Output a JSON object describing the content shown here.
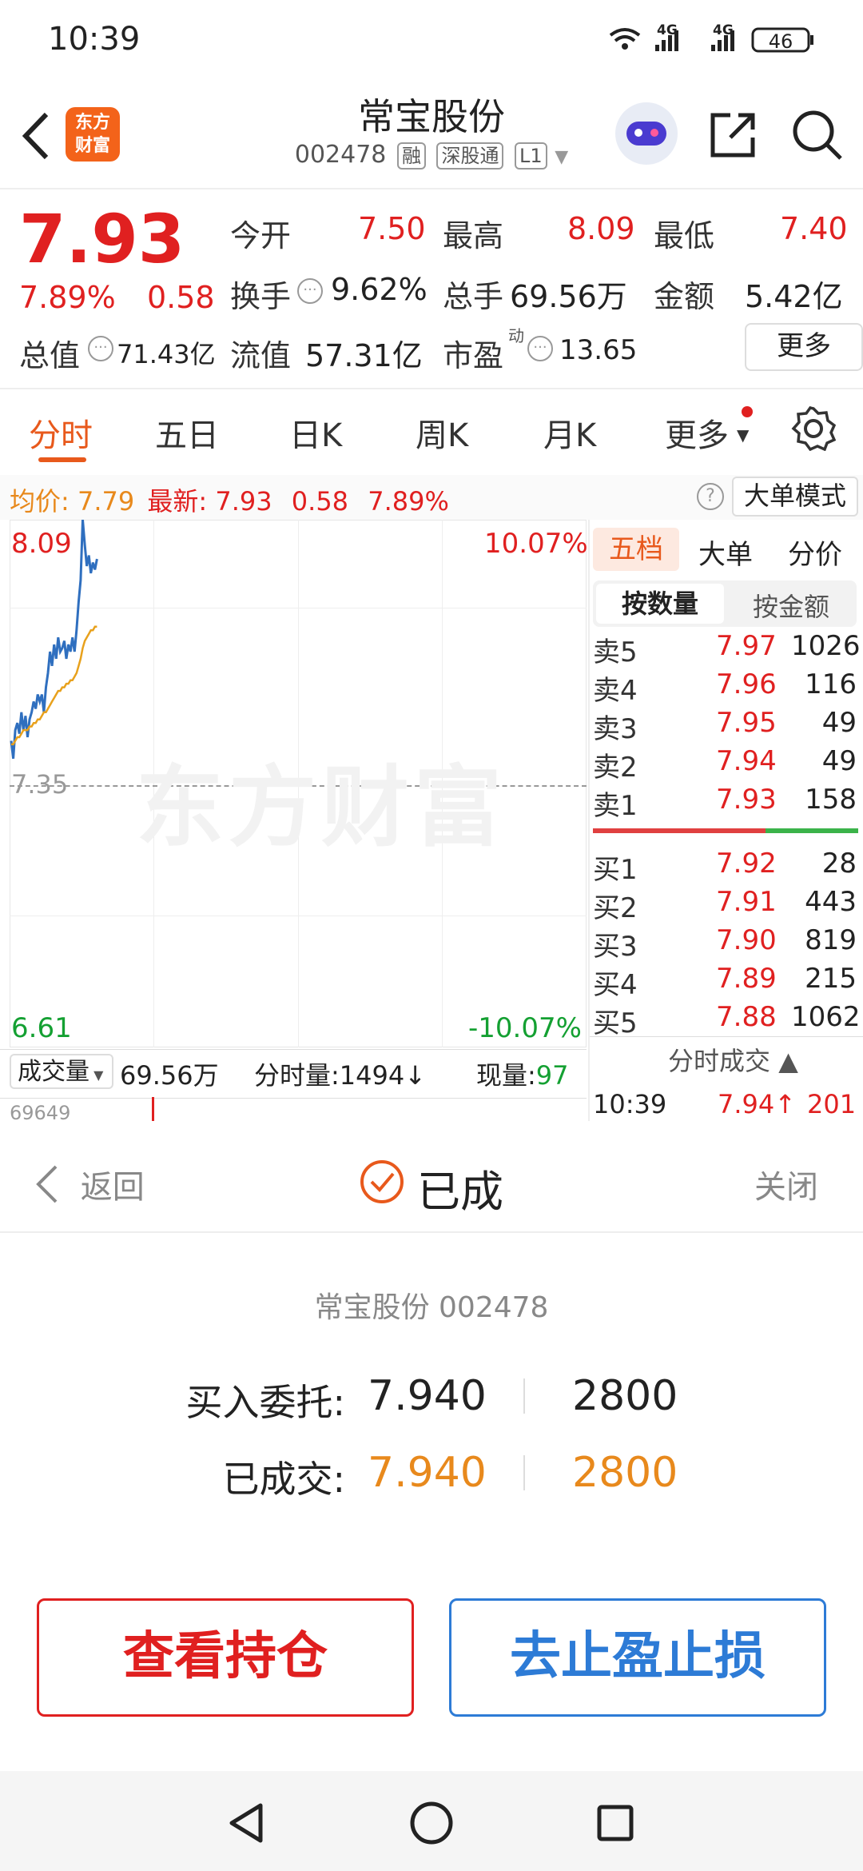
{
  "status_bar": {
    "time": "10:39",
    "network1": "4G",
    "network2": "4G",
    "battery": "46"
  },
  "header": {
    "logo_text_line1": "东方",
    "logo_text_line2": "财富",
    "stock_name": "常宝股份",
    "stock_code": "002478",
    "tags": [
      "融",
      "深股通",
      "L1"
    ]
  },
  "quote": {
    "price": "7.93",
    "change_pct": "7.89%",
    "change": "0.58",
    "open_label": "今开",
    "open": "7.50",
    "high_label": "最高",
    "high": "8.09",
    "low_label": "最低",
    "low": "7.40",
    "turnover_label": "换手",
    "turnover": "9.62%",
    "volume_label": "总手",
    "volume": "69.56万",
    "amount_label": "金额",
    "amount": "5.42亿",
    "total_value_label": "总值",
    "total_value": "71.43亿",
    "float_value_label": "流值",
    "float_value": "57.31亿",
    "pe_label": "市盈",
    "pe_superscript": "动",
    "pe": "13.65",
    "more_button": "更多"
  },
  "tabs": [
    "分时",
    "五日",
    "日K",
    "周K",
    "月K",
    "更多"
  ],
  "chart_info": {
    "avg_label": "均价:",
    "avg": "7.79",
    "latest_label": "最新:",
    "latest": "7.93",
    "change": "0.58",
    "change_pct": "7.89%",
    "mode_button": "大单模式"
  },
  "chart_data": {
    "type": "line",
    "y_top_label": "8.09",
    "y_mid_label": "7.35",
    "y_bottom_label": "6.61",
    "pct_top_label": "10.07%",
    "pct_bottom_label": "-10.07%",
    "ylim": [
      6.61,
      8.09
    ],
    "watermark": "东方财富",
    "series": [
      {
        "values": [
          7.47,
          7.42,
          7.5,
          7.52,
          7.49,
          7.55,
          7.5,
          7.54,
          7.48,
          7.53,
          7.55,
          7.58,
          7.56,
          7.6,
          7.58,
          7.6,
          7.55,
          7.62,
          7.66,
          7.72,
          7.68,
          7.74,
          7.7,
          7.76,
          7.72,
          7.73,
          7.75,
          7.7,
          7.74,
          7.72,
          7.76,
          7.72,
          7.78,
          7.86,
          7.92,
          8.09,
          8.02,
          7.96,
          7.99,
          7.94,
          7.97,
          7.95,
          7.98
        ]
      },
      {
        "values": [
          7.46,
          7.46,
          7.47,
          7.48,
          7.48,
          7.49,
          7.5,
          7.5,
          7.5,
          7.51,
          7.51,
          7.52,
          7.52,
          7.53,
          7.53,
          7.54,
          7.55,
          7.55,
          7.56,
          7.57,
          7.58,
          7.59,
          7.6,
          7.61,
          7.61,
          7.62,
          7.62,
          7.63,
          7.63,
          7.64,
          7.64,
          7.65,
          7.66,
          7.68,
          7.7,
          7.73,
          7.75,
          7.76,
          7.77,
          7.78,
          7.78,
          7.79,
          7.79
        ]
      }
    ]
  },
  "volume_bar": {
    "label": "成交量",
    "value": "69.56万",
    "minute_label": "分时量:",
    "minute_value": "1494",
    "current_label": "现量:",
    "current_value": "97",
    "axis_value": "69649"
  },
  "orderbook": {
    "tabs": [
      "五档",
      "大单",
      "分价"
    ],
    "toggle": [
      "按数量",
      "按金额"
    ],
    "asks": [
      {
        "label": "卖5",
        "price": "7.97",
        "qty": "1026"
      },
      {
        "label": "卖4",
        "price": "7.96",
        "qty": "116"
      },
      {
        "label": "卖3",
        "price": "7.95",
        "qty": "49"
      },
      {
        "label": "卖2",
        "price": "7.94",
        "qty": "49"
      },
      {
        "label": "卖1",
        "price": "7.93",
        "qty": "158"
      }
    ],
    "bids": [
      {
        "label": "买1",
        "price": "7.92",
        "qty": "28"
      },
      {
        "label": "买2",
        "price": "7.91",
        "qty": "443"
      },
      {
        "label": "买3",
        "price": "7.90",
        "qty": "819"
      },
      {
        "label": "买4",
        "price": "7.89",
        "qty": "215"
      },
      {
        "label": "买5",
        "price": "7.88",
        "qty": "1062"
      }
    ],
    "trades_label": "分时成交",
    "trade": {
      "time": "10:39",
      "price": "7.94",
      "qty": "201"
    }
  },
  "dialog": {
    "back": "返回",
    "status": "已成",
    "close": "关闭",
    "stock_line": "常宝股份 002478",
    "order_label": "买入委托:",
    "order_price": "7.940",
    "order_qty": "2800",
    "filled_label": "已成交:",
    "filled_price": "7.940",
    "filled_qty": "2800",
    "btn_position": "查看持仓",
    "btn_stop": "去止盈止损"
  },
  "colors": {
    "up": "#e02020",
    "down": "#14a032",
    "orange": "#e8891c",
    "blue": "#2d7bd6",
    "price_line": "#2f6fbf",
    "avg_line": "#e8a11c"
  }
}
